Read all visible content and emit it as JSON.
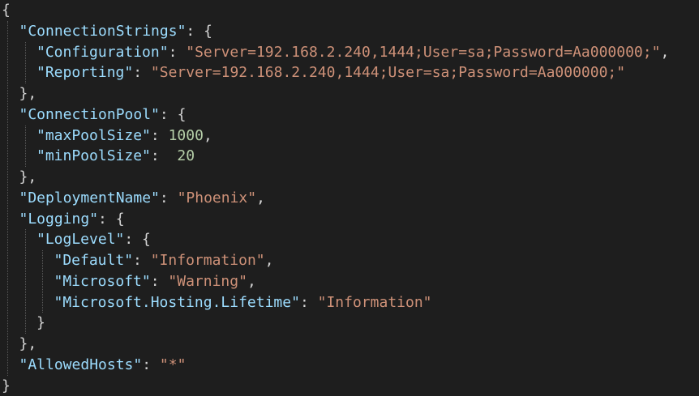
{
  "lines": [
    {
      "indent": 0,
      "parts": [
        {
          "t": "p",
          "v": "{"
        }
      ]
    },
    {
      "indent": 1,
      "parts": [
        {
          "t": "k",
          "v": "\"ConnectionStrings\""
        },
        {
          "t": "p",
          "v": ": {"
        }
      ]
    },
    {
      "indent": 2,
      "parts": [
        {
          "t": "k",
          "v": "\"Configuration\""
        },
        {
          "t": "p",
          "v": ": "
        },
        {
          "t": "s",
          "v": "\"Server=192.168.2.240,1444;User=sa;Password=Aa000000;\""
        },
        {
          "t": "p",
          "v": ","
        }
      ]
    },
    {
      "indent": 2,
      "parts": [
        {
          "t": "k",
          "v": "\"Reporting\""
        },
        {
          "t": "p",
          "v": ": "
        },
        {
          "t": "s",
          "v": "\"Server=192.168.2.240,1444;User=sa;Password=Aa000000;\""
        }
      ]
    },
    {
      "indent": 1,
      "parts": [
        {
          "t": "p",
          "v": "},"
        }
      ]
    },
    {
      "indent": 1,
      "parts": [
        {
          "t": "k",
          "v": "\"ConnectionPool\""
        },
        {
          "t": "p",
          "v": ": {"
        }
      ]
    },
    {
      "indent": 2,
      "parts": [
        {
          "t": "k",
          "v": "\"maxPoolSize\""
        },
        {
          "t": "p",
          "v": ": "
        },
        {
          "t": "n",
          "v": "1000"
        },
        {
          "t": "p",
          "v": ","
        }
      ]
    },
    {
      "indent": 2,
      "parts": [
        {
          "t": "k",
          "v": "\"minPoolSize\""
        },
        {
          "t": "p",
          "v": ":  "
        },
        {
          "t": "n",
          "v": "20"
        }
      ]
    },
    {
      "indent": 1,
      "parts": [
        {
          "t": "p",
          "v": "},"
        }
      ]
    },
    {
      "indent": 1,
      "parts": [
        {
          "t": "k",
          "v": "\"DeploymentName\""
        },
        {
          "t": "p",
          "v": ": "
        },
        {
          "t": "s",
          "v": "\"Phoenix\""
        },
        {
          "t": "p",
          "v": ","
        }
      ]
    },
    {
      "indent": 1,
      "parts": [
        {
          "t": "k",
          "v": "\"Logging\""
        },
        {
          "t": "p",
          "v": ": {"
        }
      ]
    },
    {
      "indent": 2,
      "parts": [
        {
          "t": "k",
          "v": "\"LogLevel\""
        },
        {
          "t": "p",
          "v": ": {"
        }
      ]
    },
    {
      "indent": 3,
      "parts": [
        {
          "t": "k",
          "v": "\"Default\""
        },
        {
          "t": "p",
          "v": ": "
        },
        {
          "t": "s",
          "v": "\"Information\""
        },
        {
          "t": "p",
          "v": ","
        }
      ]
    },
    {
      "indent": 3,
      "parts": [
        {
          "t": "k",
          "v": "\"Microsoft\""
        },
        {
          "t": "p",
          "v": ": "
        },
        {
          "t": "s",
          "v": "\"Warning\""
        },
        {
          "t": "p",
          "v": ","
        }
      ]
    },
    {
      "indent": 3,
      "parts": [
        {
          "t": "k",
          "v": "\"Microsoft.Hosting.Lifetime\""
        },
        {
          "t": "p",
          "v": ": "
        },
        {
          "t": "s",
          "v": "\"Information\""
        }
      ]
    },
    {
      "indent": 2,
      "parts": [
        {
          "t": "p",
          "v": "}"
        }
      ]
    },
    {
      "indent": 1,
      "parts": [
        {
          "t": "p",
          "v": "},"
        }
      ]
    },
    {
      "indent": 1,
      "parts": [
        {
          "t": "k",
          "v": "\"AllowedHosts\""
        },
        {
          "t": "p",
          "v": ": "
        },
        {
          "t": "s",
          "v": "\"*\""
        }
      ]
    },
    {
      "indent": 0,
      "parts": [
        {
          "t": "p",
          "v": "}"
        }
      ]
    }
  ],
  "colors": {
    "background": "#1e1e1e",
    "key": "#9cdcfe",
    "string": "#ce9178",
    "number": "#b5cea8",
    "punctuation": "#d4d4d4",
    "indent_guide": "#5a5a5a"
  }
}
